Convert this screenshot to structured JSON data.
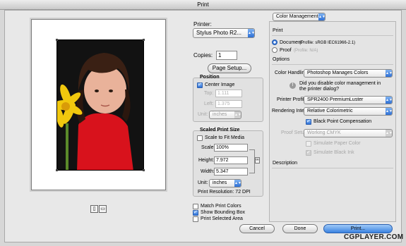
{
  "window": {
    "title": "Print"
  },
  "printer": {
    "label": "Printer:",
    "selected": "Stylus Photo R2..."
  },
  "copies": {
    "label": "Copies:",
    "value": "1"
  },
  "page_setup_label": "Page Setup...",
  "position": {
    "title": "Position",
    "center_label": "Center Image",
    "top_label": "Top:",
    "top_value": "1.111",
    "left_label": "Left:",
    "left_value": "1.375",
    "unit_label": "Unit:",
    "unit_value": "inches"
  },
  "scaled": {
    "title": "Scaled Print Size",
    "fit_label": "Scale to Fit Media",
    "scale_label": "Scale:",
    "scale_value": "100%",
    "height_label": "Height:",
    "height_value": "7.972",
    "width_label": "Width:",
    "width_value": "5.347",
    "unit_label": "Unit:",
    "unit_value": "inches",
    "resolution": "Print Resolution: 72 DPI"
  },
  "options": {
    "match_colors": "Match Print Colors",
    "bounding_box": "Show Bounding Box",
    "selected_area": "Print Selected Area"
  },
  "color_mgmt": {
    "dropdown": "Color Management",
    "print_heading": "Print",
    "document_label": "Document",
    "document_profile": "(Profile: sRGB IEC61966-2.1)",
    "proof_label": "Proof",
    "proof_profile": "(Profile: N/A)",
    "options_heading": "Options",
    "handling_label": "Color Handling:",
    "handling_value": "Photoshop Manages Colors",
    "disable_note": "Did you disable color management in the printer dialog?",
    "profile_label": "Printer Profile:",
    "profile_value": "SPR2400 PremiumLuster",
    "intent_label": "Rendering Intent:",
    "intent_value": "Relative Colorimetric",
    "bpc_label": "Black Point Compensation",
    "proof_setup_label": "Proof Setup:",
    "proof_setup_value": "Working CMYK",
    "paper_color_label": "Simulate Paper Color",
    "black_ink_label": "Simulate Black Ink",
    "description_heading": "Description"
  },
  "buttons": {
    "cancel": "Cancel",
    "done": "Done",
    "print": "Print..."
  },
  "watermark": "CGPLAYER.COM"
}
